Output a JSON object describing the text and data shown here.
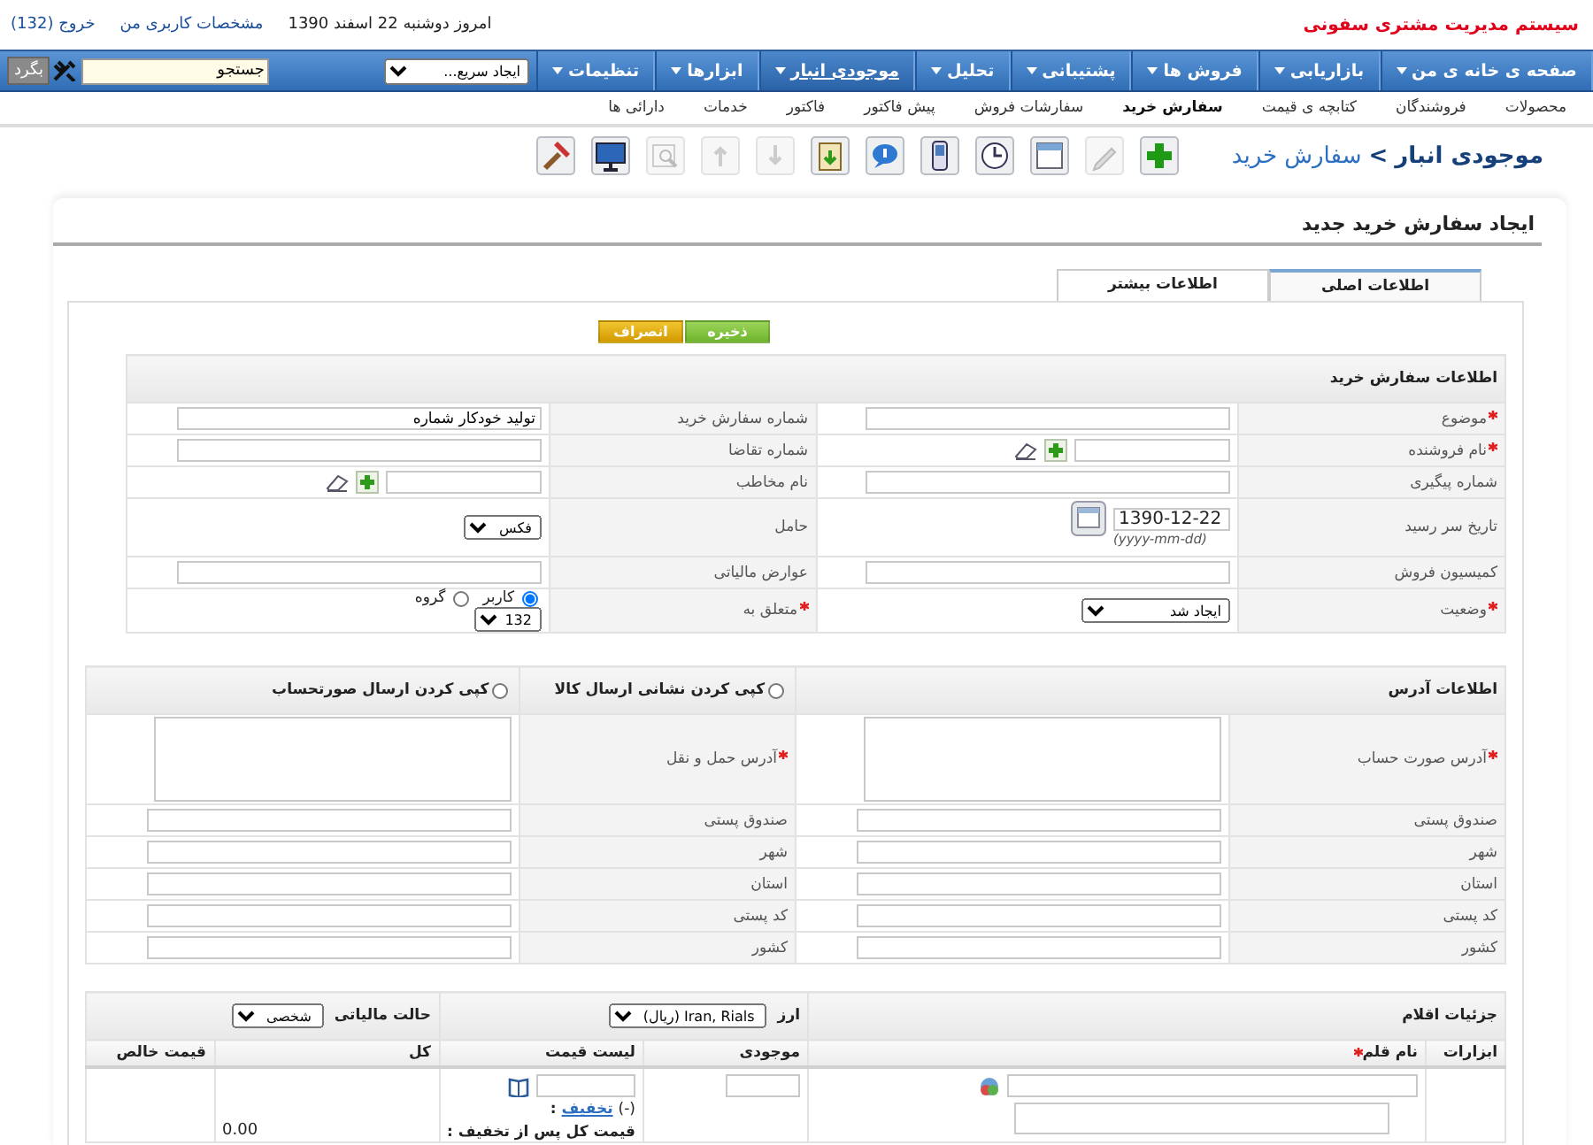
{
  "header": {
    "app_title": "سیستم مدیریت مشتری سفونی",
    "date": "امروز دوشنبه 22 اسفند 1390",
    "links": [
      "مشخصات کاربری من",
      "خروج (132)"
    ]
  },
  "menu": {
    "items": [
      {
        "label": "صفحه ی خانه ی من",
        "selected": false
      },
      {
        "label": "بازاریابی",
        "selected": false
      },
      {
        "label": "فروش ها",
        "selected": false
      },
      {
        "label": "پشتیبانی",
        "selected": false
      },
      {
        "label": "تحلیل",
        "selected": false
      },
      {
        "label": "موجودی انبار",
        "selected": true
      },
      {
        "label": "ابزارها",
        "selected": false
      },
      {
        "label": "تنظیمات",
        "selected": false
      }
    ],
    "quick_create": "ایجاد سریع...",
    "search": {
      "value": "جستجو"
    },
    "search_button": "بگرد"
  },
  "submenu": [
    {
      "label": "محصولات",
      "selected": false
    },
    {
      "label": "فروشندگان",
      "selected": false
    },
    {
      "label": "کتابچه ی قیمت",
      "selected": false
    },
    {
      "label": "سفارش خرید",
      "selected": true
    },
    {
      "label": "سفارشات فروش",
      "selected": false
    },
    {
      "label": "پیش فاکتور",
      "selected": false
    },
    {
      "label": "فاکتور",
      "selected": false
    },
    {
      "label": "خدمات",
      "selected": false
    },
    {
      "label": "دارائی ها",
      "selected": false
    }
  ],
  "breadcrumb": {
    "module": "موجودی انبار",
    "separator": ">",
    "page": "سفارش خرید"
  },
  "toolbar": [
    {
      "kind": "add",
      "disabled": false
    },
    {
      "kind": "pencil",
      "disabled": true
    },
    {
      "kind": "calendar",
      "disabled": false
    },
    {
      "kind": "clock",
      "disabled": false
    },
    {
      "kind": "phone",
      "disabled": false
    },
    {
      "kind": "chat",
      "disabled": false
    },
    {
      "kind": "clipboard",
      "disabled": false
    },
    {
      "kind": "down",
      "disabled": true
    },
    {
      "kind": "up",
      "disabled": true
    },
    {
      "kind": "search",
      "disabled": true
    },
    {
      "kind": "monitor",
      "disabled": false
    },
    {
      "kind": "hammer",
      "disabled": false
    }
  ],
  "page_title": "ایجاد سفارش خرید جدید",
  "tabs": [
    {
      "label": "اطلاعات اصلی",
      "selected": true
    },
    {
      "label": "اطلاعات بیشتر",
      "selected": false
    }
  ],
  "buttons": [
    {
      "label": "ذخیره",
      "kind": "save"
    },
    {
      "label": "انصراف",
      "kind": "cancel"
    }
  ],
  "purchase_info": {
    "title": "اطلاعات سفارش خرید",
    "rows": [
      [
        {
          "label": "موضوع",
          "required": true,
          "kind": "text"
        },
        {
          "label": "شماره سفارش خرید",
          "required": false,
          "kind": "text",
          "value": "تولید خودکار شماره"
        }
      ],
      [
        {
          "label": "نام فروشنده",
          "required": true,
          "kind": "lookup"
        },
        {
          "label": "شماره تقاضا",
          "required": false,
          "kind": "text"
        }
      ],
      [
        {
          "label": "شماره پیگیری",
          "required": false,
          "kind": "text"
        },
        {
          "label": "نام مخاطب",
          "required": false,
          "kind": "lookup"
        }
      ],
      [
        {
          "label": "تاریخ سر رسید",
          "required": false,
          "kind": "date",
          "value": "1390-12-22",
          "hint": "(yyyy-mm-dd)"
        },
        {
          "label": "حامل",
          "required": false,
          "kind": "select",
          "value": "فکس"
        }
      ],
      [
        {
          "label": "کمیسیون فروش",
          "required": false,
          "kind": "text"
        },
        {
          "label": "عوارض مالیاتی",
          "required": false,
          "kind": "text"
        }
      ],
      [
        {
          "label": "وضعیت",
          "required": true,
          "kind": "select",
          "value": "ایجاد شد"
        },
        {
          "label": "متعلق به",
          "required": true,
          "kind": "assign",
          "options": [
            {
              "label": "کاربر",
              "selected": true
            },
            {
              "label": "گروه",
              "selected": false
            }
          ],
          "value": "132"
        }
      ]
    ]
  },
  "address_info": {
    "title": "اطلاعات آدرس",
    "copy_options": [
      {
        "label": "کپی کردن نشانی ارسال کالا",
        "selected": false
      },
      {
        "label": "کپی کردن ارسال صورتحساب",
        "selected": false
      }
    ],
    "rows": [
      [
        {
          "label": "آدرس صورت حساب",
          "required": true,
          "kind": "textarea"
        },
        {
          "label": "آدرس حمل و نقل",
          "required": true,
          "kind": "textarea"
        }
      ],
      [
        {
          "label": "صندوق پستی",
          "required": false,
          "kind": "text"
        },
        {
          "label": "صندوق پستی",
          "required": false,
          "kind": "text"
        }
      ],
      [
        {
          "label": "شهر",
          "required": false,
          "kind": "text"
        },
        {
          "label": "شهر",
          "required": false,
          "kind": "text"
        }
      ],
      [
        {
          "label": "استان",
          "required": false,
          "kind": "text"
        },
        {
          "label": "استان",
          "required": false,
          "kind": "text"
        }
      ],
      [
        {
          "label": "کد پستی",
          "required": false,
          "kind": "text"
        },
        {
          "label": "کد پستی",
          "required": false,
          "kind": "text"
        }
      ],
      [
        {
          "label": "کشور",
          "required": false,
          "kind": "text"
        },
        {
          "label": "کشور",
          "required": false,
          "kind": "text"
        }
      ]
    ]
  },
  "items": {
    "title": "جزئیات اقلام",
    "currency": {
      "label": "ارز",
      "value": "Iran, Rials (ریال)"
    },
    "tax_mode": {
      "label": "حالت مالیاتی",
      "value": "شخصی"
    },
    "columns": [
      {
        "label": "ابزارات",
        "required": false
      },
      {
        "label": "نام قلم",
        "required": true
      },
      {
        "label": "موجودی",
        "required": false
      },
      {
        "label": "لیست قیمت",
        "required": false
      },
      {
        "label": "کل",
        "required": false
      },
      {
        "label": "قیمت خالص",
        "required": false
      }
    ],
    "rows": [
      {
        "discount_prefix": "(-)",
        "discount_link": "تخفیف",
        "discount_suffix": ":",
        "after_discount": "قیمت کل پس از تخفیف :",
        "total": "0.00"
      }
    ]
  }
}
